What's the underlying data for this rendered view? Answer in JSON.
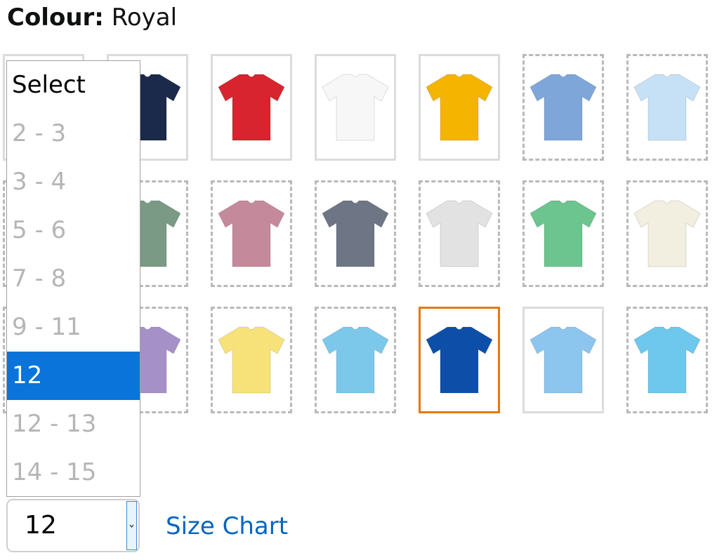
{
  "colour": {
    "label": "Colour:",
    "value": "Royal"
  },
  "swatches": [
    {
      "color": "#1b2a4a",
      "available": true,
      "selected": false
    },
    {
      "color": "#1b2a4a",
      "available": true,
      "selected": false
    },
    {
      "color": "#d8242f",
      "available": true,
      "selected": false
    },
    {
      "color": "#f7f7f7",
      "available": true,
      "selected": false
    },
    {
      "color": "#f5b400",
      "available": true,
      "selected": false
    },
    {
      "color": "#7fa6d8",
      "available": false,
      "selected": false
    },
    {
      "color": "#c6e1f5",
      "available": false,
      "selected": false
    },
    {
      "color": "#7a9a85",
      "available": false,
      "selected": false
    },
    {
      "color": "#7a9a85",
      "available": false,
      "selected": false
    },
    {
      "color": "#c48a9b",
      "available": false,
      "selected": false
    },
    {
      "color": "#6e7585",
      "available": false,
      "selected": false
    },
    {
      "color": "#e2e2e2",
      "available": false,
      "selected": false
    },
    {
      "color": "#6cc48f",
      "available": false,
      "selected": false
    },
    {
      "color": "#f2eee0",
      "available": false,
      "selected": false
    },
    {
      "color": "#a591c8",
      "available": false,
      "selected": false
    },
    {
      "color": "#a591c8",
      "available": false,
      "selected": false
    },
    {
      "color": "#f7e27a",
      "available": false,
      "selected": false
    },
    {
      "color": "#7cc8ea",
      "available": false,
      "selected": false
    },
    {
      "color": "#0d4fa8",
      "available": true,
      "selected": true
    },
    {
      "color": "#8cc5ee",
      "available": true,
      "selected": false
    },
    {
      "color": "#6ec7ec",
      "available": false,
      "selected": false
    }
  ],
  "size": {
    "options": [
      {
        "label": "Select",
        "enabled": true,
        "highlighted": false
      },
      {
        "label": "2 - 3",
        "enabled": false,
        "highlighted": false
      },
      {
        "label": "3 - 4",
        "enabled": false,
        "highlighted": false
      },
      {
        "label": "5 - 6",
        "enabled": false,
        "highlighted": false
      },
      {
        "label": "7 - 8",
        "enabled": false,
        "highlighted": false
      },
      {
        "label": "9 - 11",
        "enabled": false,
        "highlighted": false
      },
      {
        "label": "12",
        "enabled": true,
        "highlighted": true
      },
      {
        "label": "12 - 13",
        "enabled": false,
        "highlighted": false
      },
      {
        "label": "14 - 15",
        "enabled": false,
        "highlighted": false
      }
    ],
    "selected_value": "12",
    "size_chart_label": "Size Chart"
  },
  "icons": {
    "swatch": "tshirt-icon",
    "dropdown_arrow": "chevron-down-icon"
  }
}
